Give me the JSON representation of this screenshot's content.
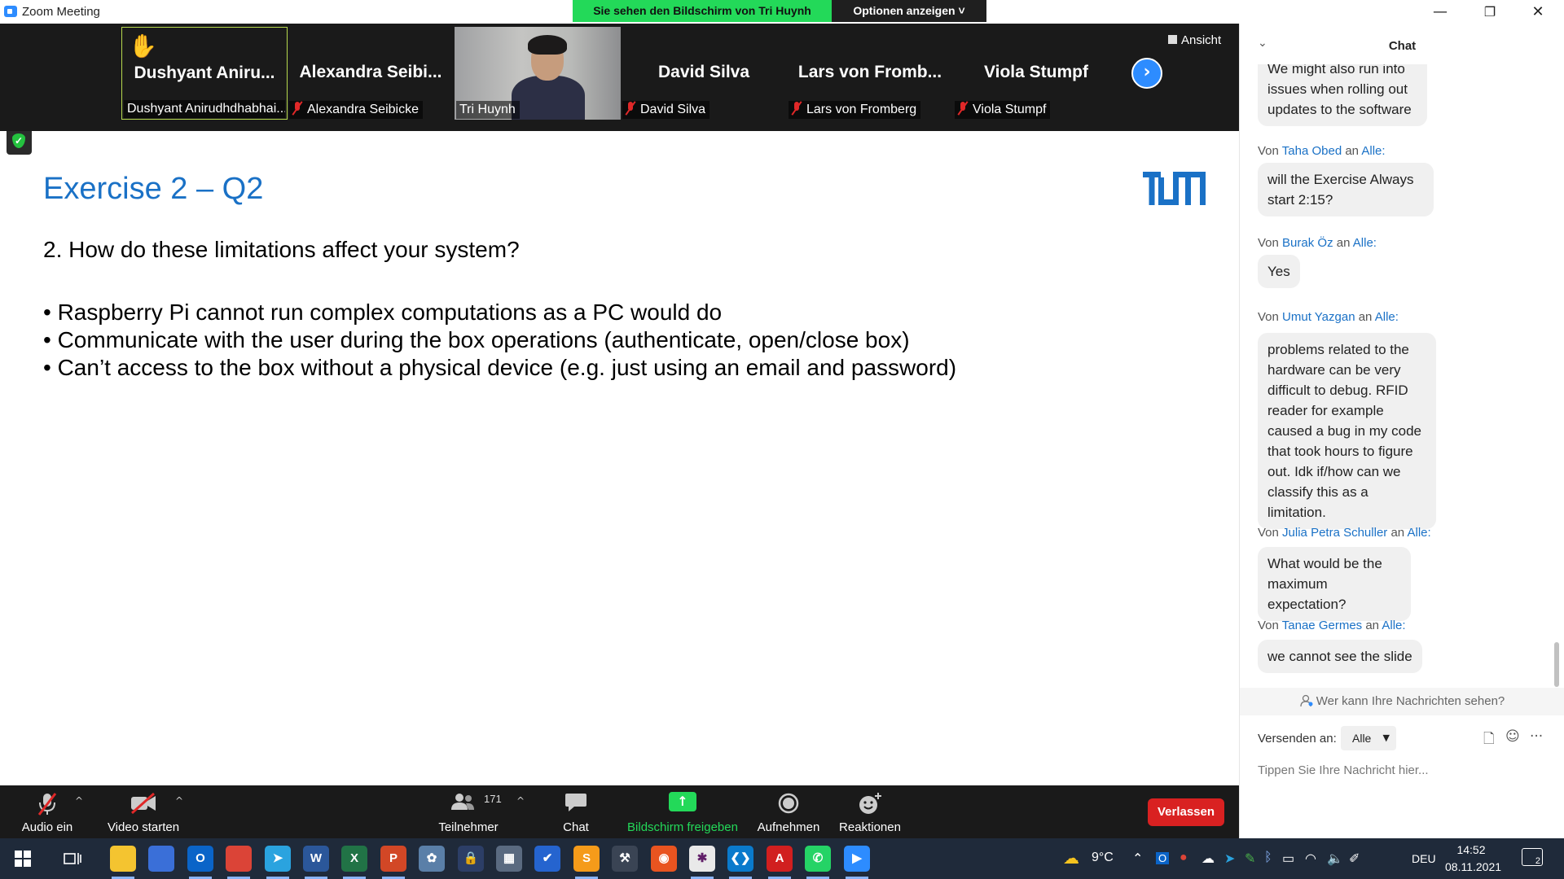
{
  "window": {
    "title": "Zoom Meeting",
    "share_banner": "Sie sehen den Bildschirm von Tri Huynh",
    "options_label": "Optionen anzeigen ˅",
    "minimize": "—",
    "restore": "❐",
    "close": "✕"
  },
  "participants": [
    {
      "name_big": "Dushyant Aniru...",
      "name_small": "Dushyant Anirudhdhabhai...",
      "hand": "✋"
    },
    {
      "name_big": "Alexandra  Seibi...",
      "name_small": "Alexandra Seibicke"
    },
    {
      "name_small": "Tri Huynh"
    },
    {
      "name_big": "David Silva",
      "name_small": "David Silva"
    },
    {
      "name_big": "Lars von Fromb...",
      "name_small": "Lars von Fromberg"
    },
    {
      "name_big": "Viola Stumpf",
      "name_small": "Viola Stumpf"
    }
  ],
  "next_icon": "›",
  "view_label": "Ansicht",
  "slide": {
    "title": "Exercise 2 – Q2",
    "question": "2. How do these limitations affect your system?",
    "bullets": [
      "• Raspberry Pi cannot run complex computations as a PC would do",
      "• Communicate with the user during the box operations (authenticate, open/close box)",
      "• Can’t access to the box without a physical device (e.g. just using an email and password)"
    ]
  },
  "toolbar": {
    "audio": "Audio ein",
    "video": "Video starten",
    "participants": "Teilnehmer",
    "participants_count": "171",
    "chat": "Chat",
    "share": "Bildschirm freigeben",
    "record": "Aufnehmen",
    "reactions": "Reaktionen",
    "leave": "Verlassen",
    "caret": "^"
  },
  "chat": {
    "title": "Chat",
    "collapse_icon": "⌄",
    "from_prefix": "Von",
    "to_word": "an",
    "partial_message": "We might also run into issues when rolling out updates to the software",
    "messages": [
      {
        "from": "Taha Obed",
        "to": "Alle:",
        "text": "will the Exercise Always start 2:15?"
      },
      {
        "from": "Burak Öz",
        "to": "Alle:",
        "text": "Yes"
      },
      {
        "from": "Umut Yazgan",
        "to": "Alle:",
        "text": "problems related to the hardware can be very difficult to debug. RFID reader for example caused a bug in my code that took hours to figure out. Idk if/how can we classify this as a limitation."
      },
      {
        "from": "Julia Petra Schuller",
        "to": "Alle:",
        "text": "What would be the maximum expectation?"
      },
      {
        "from": "Tanae Germes",
        "to": "Alle:",
        "text": "we cannot see the slide"
      }
    ],
    "who_sees": "Wer kann Ihre Nachrichten sehen?",
    "send_to_label": "Versenden an:",
    "recipient": "Alle",
    "input_placeholder": "Tippen Sie Ihre Nachricht hier...",
    "tools": [
      "🗋",
      "☺",
      "···"
    ]
  },
  "taskbar": {
    "apps": [
      {
        "name": "file-explorer-icon",
        "glyph": "",
        "color": "#f4c430"
      },
      {
        "name": "store-icon",
        "glyph": "",
        "color": "#3a6fd8"
      },
      {
        "name": "outlook-icon",
        "glyph": "O",
        "color": "#0a64c8"
      },
      {
        "name": "chrome-icon",
        "glyph": "",
        "color": "#db4437"
      },
      {
        "name": "telegram-icon",
        "glyph": "➤",
        "color": "#2aa3df"
      },
      {
        "name": "word-icon",
        "glyph": "W",
        "color": "#2b579a"
      },
      {
        "name": "excel-icon",
        "glyph": "X",
        "color": "#217346"
      },
      {
        "name": "powerpoint-icon",
        "glyph": "P",
        "color": "#d24726"
      },
      {
        "name": "paint-icon",
        "glyph": "✿",
        "color": "#5a7fa8"
      },
      {
        "name": "vpn-icon",
        "glyph": "🔒",
        "color": "#2c3e66"
      },
      {
        "name": "calculator-icon",
        "glyph": "▦",
        "color": "#5a6a80"
      },
      {
        "name": "todo-icon",
        "glyph": "✔",
        "color": "#2564cf"
      },
      {
        "name": "sublime-icon",
        "glyph": "S",
        "color": "#f59b1a"
      },
      {
        "name": "tools-icon",
        "glyph": "⚒",
        "color": "#3a4454"
      },
      {
        "name": "ubuntu-icon",
        "glyph": "◉",
        "color": "#e95420"
      },
      {
        "name": "slack-icon",
        "glyph": "✱",
        "color": "#e9e9e9"
      },
      {
        "name": "vscode-icon",
        "glyph": "❮❯",
        "color": "#0a7acc"
      },
      {
        "name": "acrobat-icon",
        "glyph": "A",
        "color": "#d11f1f"
      },
      {
        "name": "whatsapp-icon",
        "glyph": "✆",
        "color": "#25d366"
      },
      {
        "name": "zoom-icon",
        "glyph": "▶",
        "color": "#2d8cff"
      }
    ],
    "weather": "9°C",
    "language": "DEU",
    "time": "14:52",
    "date": "08.11.2021",
    "notifications": "2"
  }
}
